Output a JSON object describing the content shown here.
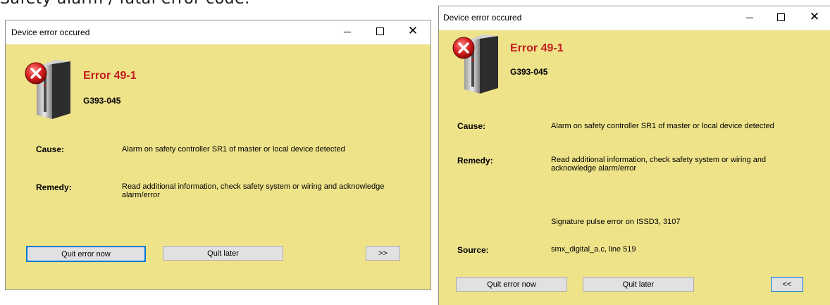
{
  "page_heading": "Safety alarm / fatal error code:",
  "window_title": "Device error occured",
  "error_title": "Error 49-1",
  "error_code": "G393-045",
  "cause_label": "Cause:",
  "cause_text": "Alarm on safety controller SR1 of master or local device detected",
  "remedy_label": "Remedy:",
  "remedy_text": "Read additional information, check safety system or wiring and acknowledge alarm/error",
  "details": {
    "signature_text": "Signature pulse error on ISSD3, 3107",
    "source_label": "Source:",
    "source_text": "smx_digital_a.c, line 519"
  },
  "buttons": {
    "quit_now": "Quit error now",
    "quit_later": "Quit later",
    "expand": ">>",
    "collapse": "<<"
  },
  "window_controls": {
    "minimize": "minimize-icon",
    "maximize": "maximize-icon",
    "close": "close-icon"
  },
  "icons": {
    "device": "device-error-icon"
  },
  "colors": {
    "dialog_bg": "#efe38a",
    "error_title": "#c41e1e",
    "focus_border": "#0078d7",
    "button_bg": "#e1e1e1"
  }
}
